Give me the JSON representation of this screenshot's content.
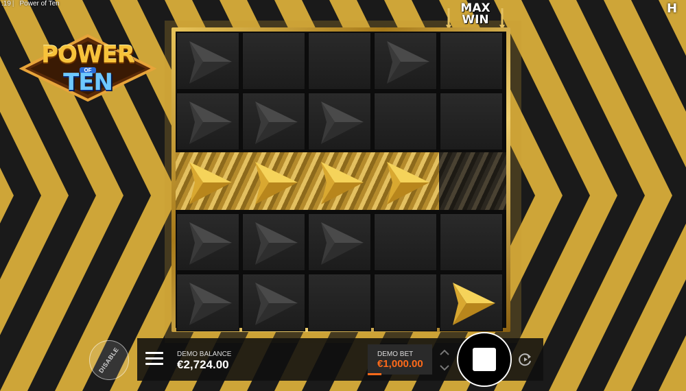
{
  "statusbar": {
    "time": ":19",
    "title": "Power of Ten"
  },
  "logo": {
    "line1": "POWER",
    "of": "OF",
    "line2": "TEN"
  },
  "maxwin": {
    "line1": "MAX",
    "line2": "WIN"
  },
  "provider": {
    "initial": "H"
  },
  "board": {
    "rows": [
      [
        "grey-arrow-icon",
        "empty",
        "empty",
        "grey-arrow-icon",
        "empty"
      ],
      [
        "grey-arrow-icon",
        "grey-arrow-icon",
        "grey-arrow-icon",
        "empty",
        "empty"
      ],
      [
        "gold-arrow-icon",
        "gold-arrow-icon",
        "gold-arrow-icon",
        "gold-arrow-icon",
        "dark-chevrons"
      ],
      [
        "grey-arrow-icon",
        "grey-arrow-icon",
        "grey-arrow-icon",
        "empty",
        "empty"
      ],
      [
        "grey-arrow-icon",
        "grey-arrow-icon",
        "empty",
        "empty",
        "gold-arrow-icon"
      ]
    ]
  },
  "controls": {
    "disable_label": "DISABLE",
    "balance_label": "DEMO BALANCE",
    "balance_value": "€2,724.00",
    "bet_label": "DEMO BET",
    "bet_value": "€1,000.00"
  },
  "colors": {
    "accent": "#ff6a1a",
    "gold": "#e3c060",
    "cell": "#222222"
  }
}
